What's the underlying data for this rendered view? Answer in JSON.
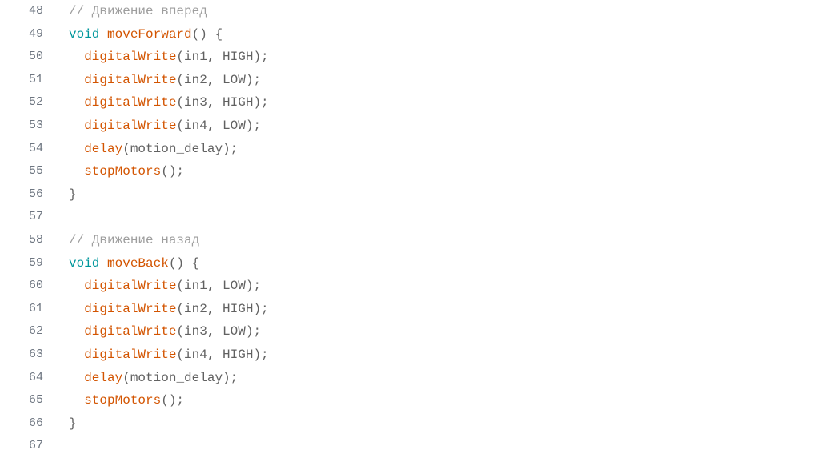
{
  "chart_data": null,
  "editor": {
    "startLine": 48,
    "lines": [
      {
        "indent": 0,
        "tokens": [
          {
            "t": "comment",
            "v": "// Движение вперед"
          }
        ]
      },
      {
        "indent": 0,
        "tokens": [
          {
            "t": "keyword",
            "v": "void"
          },
          {
            "t": "space",
            "v": " "
          },
          {
            "t": "func",
            "v": "moveForward"
          },
          {
            "t": "punct",
            "v": "()"
          },
          {
            "t": "space",
            "v": " "
          },
          {
            "t": "brace",
            "v": "{"
          }
        ]
      },
      {
        "indent": 1,
        "tokens": [
          {
            "t": "func",
            "v": "digitalWrite"
          },
          {
            "t": "punct",
            "v": "("
          },
          {
            "t": "ident",
            "v": "in1"
          },
          {
            "t": "punct",
            "v": ", "
          },
          {
            "t": "ident",
            "v": "HIGH"
          },
          {
            "t": "punct",
            "v": ");"
          }
        ]
      },
      {
        "indent": 1,
        "tokens": [
          {
            "t": "func",
            "v": "digitalWrite"
          },
          {
            "t": "punct",
            "v": "("
          },
          {
            "t": "ident",
            "v": "in2"
          },
          {
            "t": "punct",
            "v": ", "
          },
          {
            "t": "ident",
            "v": "LOW"
          },
          {
            "t": "punct",
            "v": ");"
          }
        ]
      },
      {
        "indent": 1,
        "tokens": [
          {
            "t": "func",
            "v": "digitalWrite"
          },
          {
            "t": "punct",
            "v": "("
          },
          {
            "t": "ident",
            "v": "in3"
          },
          {
            "t": "punct",
            "v": ", "
          },
          {
            "t": "ident",
            "v": "HIGH"
          },
          {
            "t": "punct",
            "v": ");"
          }
        ]
      },
      {
        "indent": 1,
        "tokens": [
          {
            "t": "func",
            "v": "digitalWrite"
          },
          {
            "t": "punct",
            "v": "("
          },
          {
            "t": "ident",
            "v": "in4"
          },
          {
            "t": "punct",
            "v": ", "
          },
          {
            "t": "ident",
            "v": "LOW"
          },
          {
            "t": "punct",
            "v": ");"
          }
        ]
      },
      {
        "indent": 1,
        "tokens": [
          {
            "t": "func",
            "v": "delay"
          },
          {
            "t": "punct",
            "v": "("
          },
          {
            "t": "ident",
            "v": "motion_delay"
          },
          {
            "t": "punct",
            "v": ");"
          }
        ]
      },
      {
        "indent": 1,
        "tokens": [
          {
            "t": "func",
            "v": "stopMotors"
          },
          {
            "t": "punct",
            "v": "();"
          }
        ]
      },
      {
        "indent": 0,
        "tokens": [
          {
            "t": "brace",
            "v": "}"
          }
        ]
      },
      {
        "indent": 0,
        "tokens": []
      },
      {
        "indent": 0,
        "tokens": [
          {
            "t": "comment",
            "v": "// Движение назад"
          }
        ]
      },
      {
        "indent": 0,
        "tokens": [
          {
            "t": "keyword",
            "v": "void"
          },
          {
            "t": "space",
            "v": " "
          },
          {
            "t": "func",
            "v": "moveBack"
          },
          {
            "t": "punct",
            "v": "()"
          },
          {
            "t": "space",
            "v": " "
          },
          {
            "t": "brace",
            "v": "{"
          }
        ]
      },
      {
        "indent": 1,
        "tokens": [
          {
            "t": "func",
            "v": "digitalWrite"
          },
          {
            "t": "punct",
            "v": "("
          },
          {
            "t": "ident",
            "v": "in1"
          },
          {
            "t": "punct",
            "v": ", "
          },
          {
            "t": "ident",
            "v": "LOW"
          },
          {
            "t": "punct",
            "v": ");"
          }
        ]
      },
      {
        "indent": 1,
        "tokens": [
          {
            "t": "func",
            "v": "digitalWrite"
          },
          {
            "t": "punct",
            "v": "("
          },
          {
            "t": "ident",
            "v": "in2"
          },
          {
            "t": "punct",
            "v": ", "
          },
          {
            "t": "ident",
            "v": "HIGH"
          },
          {
            "t": "punct",
            "v": ");"
          }
        ]
      },
      {
        "indent": 1,
        "tokens": [
          {
            "t": "func",
            "v": "digitalWrite"
          },
          {
            "t": "punct",
            "v": "("
          },
          {
            "t": "ident",
            "v": "in3"
          },
          {
            "t": "punct",
            "v": ", "
          },
          {
            "t": "ident",
            "v": "LOW"
          },
          {
            "t": "punct",
            "v": ");"
          }
        ]
      },
      {
        "indent": 1,
        "tokens": [
          {
            "t": "func",
            "v": "digitalWrite"
          },
          {
            "t": "punct",
            "v": "("
          },
          {
            "t": "ident",
            "v": "in4"
          },
          {
            "t": "punct",
            "v": ", "
          },
          {
            "t": "ident",
            "v": "HIGH"
          },
          {
            "t": "punct",
            "v": ");"
          }
        ]
      },
      {
        "indent": 1,
        "tokens": [
          {
            "t": "func",
            "v": "delay"
          },
          {
            "t": "punct",
            "v": "("
          },
          {
            "t": "ident",
            "v": "motion_delay"
          },
          {
            "t": "punct",
            "v": ");"
          }
        ]
      },
      {
        "indent": 1,
        "tokens": [
          {
            "t": "func",
            "v": "stopMotors"
          },
          {
            "t": "punct",
            "v": "();"
          }
        ]
      },
      {
        "indent": 0,
        "tokens": [
          {
            "t": "brace",
            "v": "}"
          }
        ]
      },
      {
        "indent": 0,
        "tokens": []
      }
    ]
  }
}
